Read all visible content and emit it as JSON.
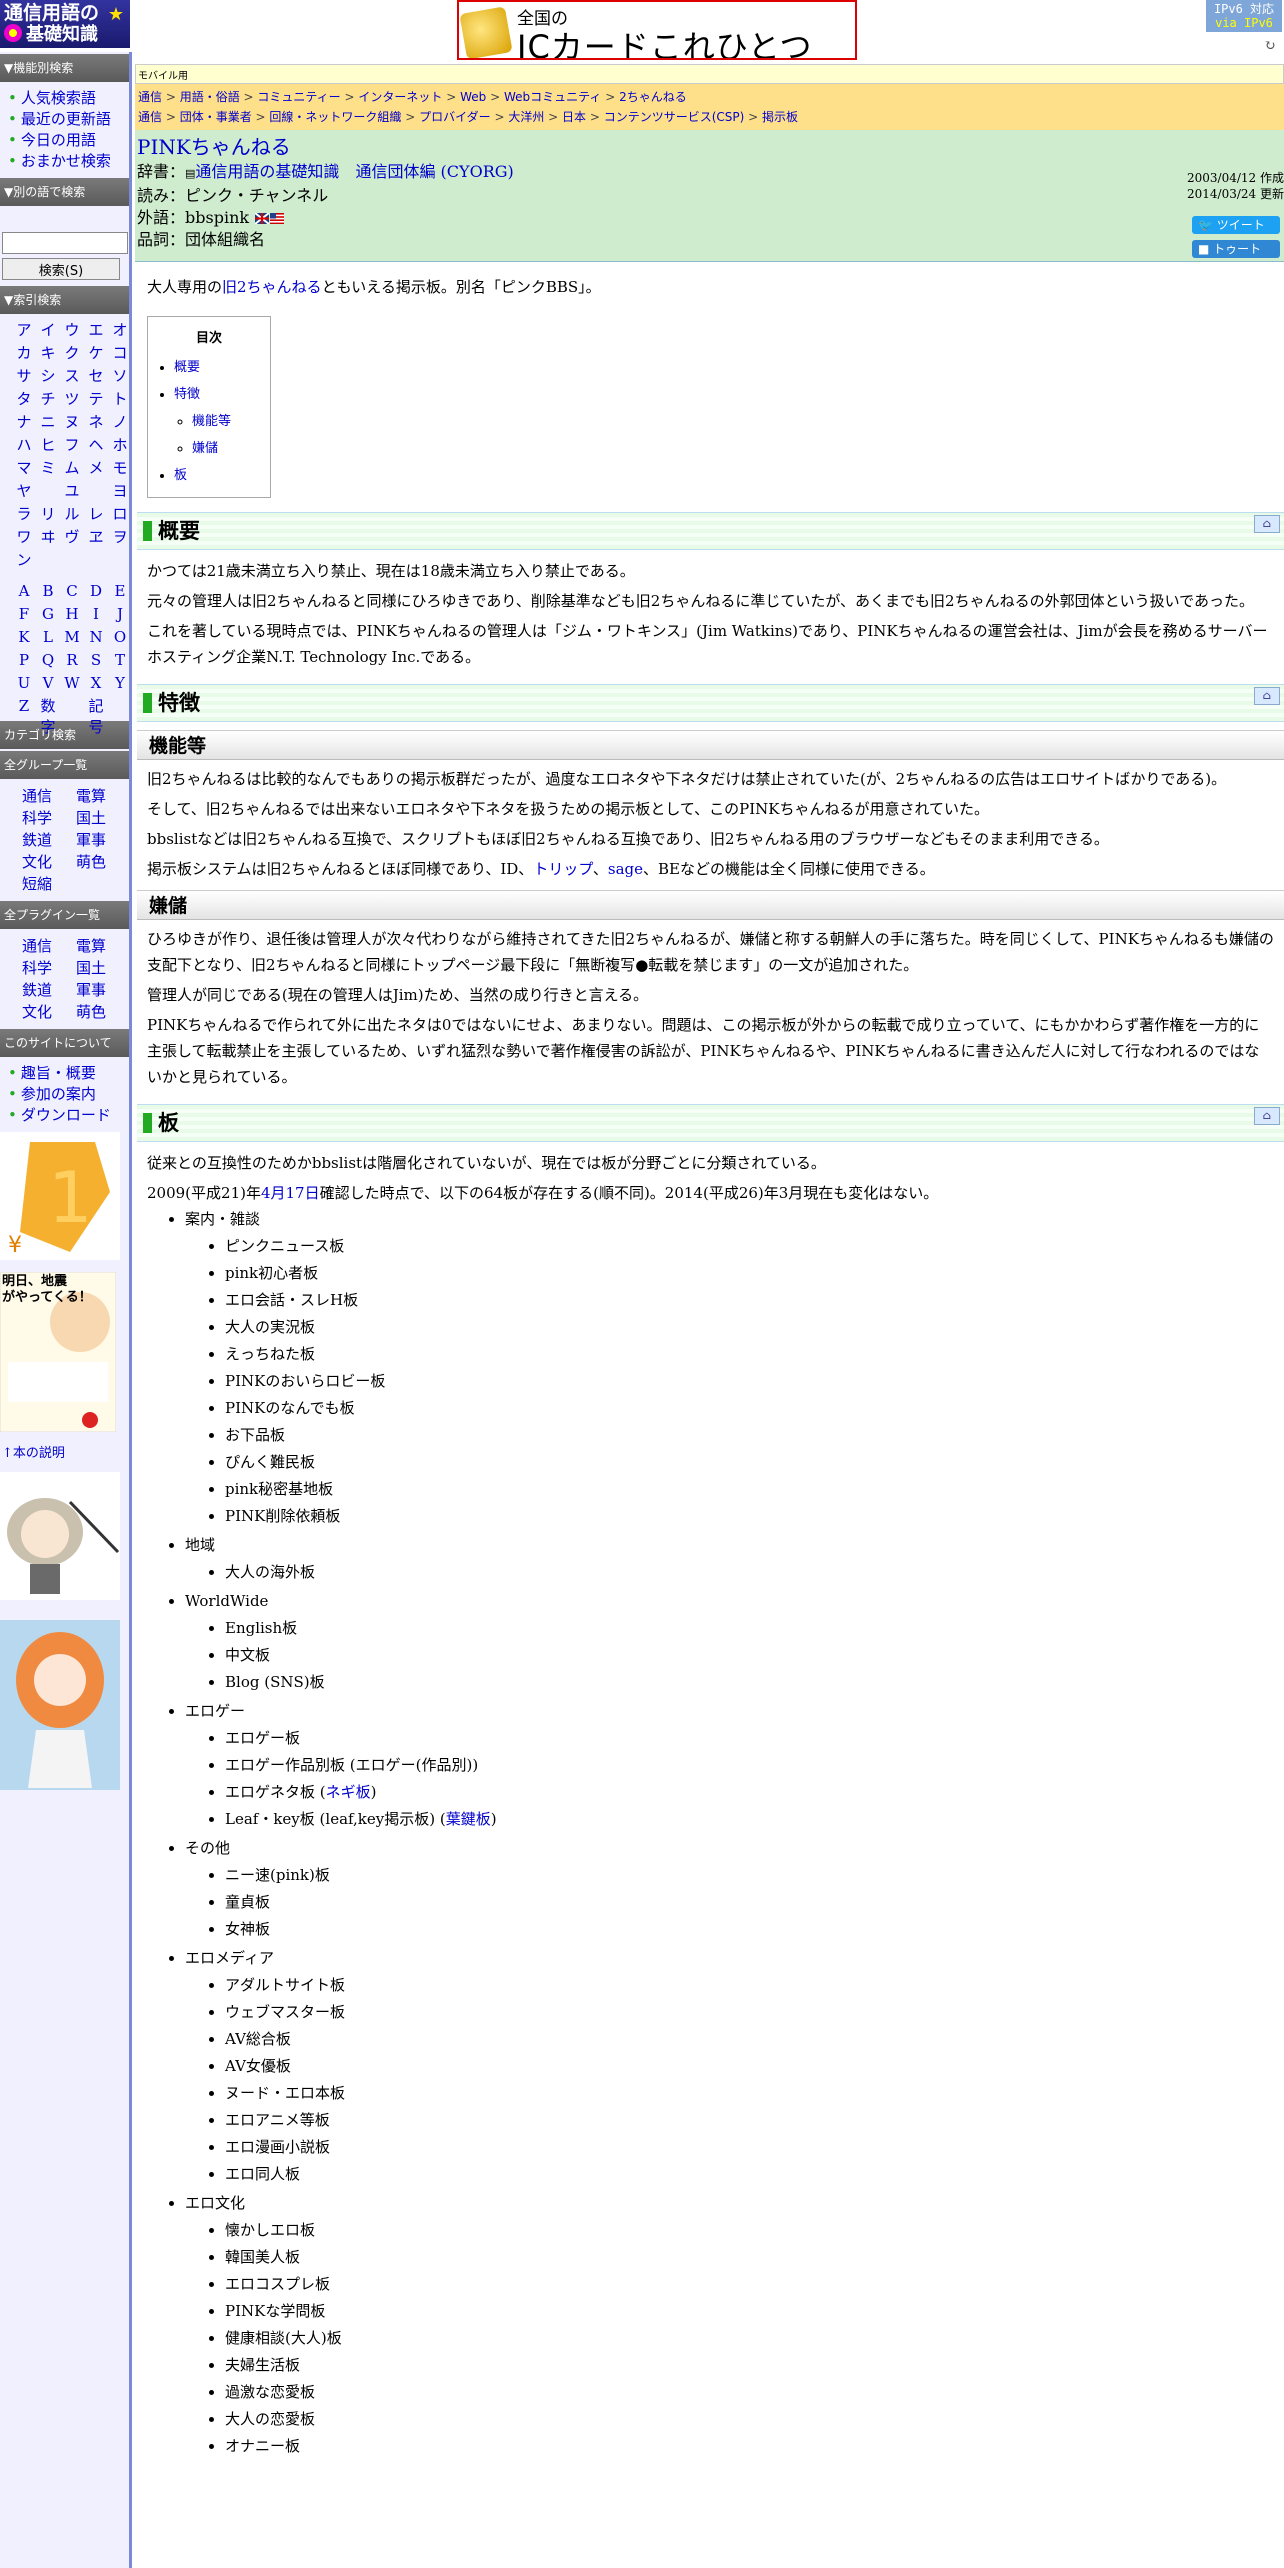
{
  "header": {
    "logo_line1": "通信用語の",
    "logo_line2": "基礎知識",
    "banner_small": "全国の",
    "banner_big": "ICカードこれひとつ",
    "ipv6_line1": "IPv6 対応",
    "ipv6_line2": "via IPv6"
  },
  "sidebar": {
    "feature_search_title": "▼機能別検索",
    "feature_links": [
      "人気検索語",
      "最近の更新語",
      "今日の用語",
      "おまかせ検索"
    ],
    "word_search_title": "▼別の語で検索",
    "search_button": "検索(S)",
    "index_title": "▼索引検索",
    "kana": [
      "ア",
      "イ",
      "ウ",
      "エ",
      "オ",
      "カ",
      "キ",
      "ク",
      "ケ",
      "コ",
      "サ",
      "シ",
      "ス",
      "セ",
      "ソ",
      "タ",
      "チ",
      "ツ",
      "テ",
      "ト",
      "ナ",
      "ニ",
      "ヌ",
      "ネ",
      "ノ",
      "ハ",
      "ヒ",
      "フ",
      "ヘ",
      "ホ",
      "マ",
      "ミ",
      "ム",
      "メ",
      "モ",
      "ヤ",
      "",
      "ユ",
      "",
      "ヨ",
      "ラ",
      "リ",
      "ル",
      "レ",
      "ロ",
      "ワ",
      "ヰ",
      "ヴ",
      "ヱ",
      "ヲ",
      "ン",
      "",
      "",
      "",
      ""
    ],
    "alpha": [
      "A",
      "B",
      "C",
      "D",
      "E",
      "F",
      "G",
      "H",
      "I",
      "J",
      "K",
      "L",
      "M",
      "N",
      "O",
      "P",
      "Q",
      "R",
      "S",
      "T",
      "U",
      "V",
      "W",
      "X",
      "Y",
      "Z",
      "数字",
      "",
      "記号",
      ""
    ],
    "category_title": "カテゴリ検索",
    "group_title": "全グループ一覧",
    "groups": [
      "通信",
      "電算",
      "科学",
      "国土",
      "鉄道",
      "軍事",
      "文化",
      "萌色",
      "短縮",
      ""
    ],
    "plugin_title": "全プラグイン一覧",
    "plugins": [
      "通信",
      "電算",
      "科学",
      "国土",
      "鉄道",
      "軍事",
      "文化",
      "萌色"
    ],
    "about_title": "このサイトについて",
    "about_links": [
      "趣旨・概要",
      "参加の案内",
      "ダウンロード"
    ],
    "ad_caption": "↑本の説明",
    "book_line1": "明日、地震",
    "book_line2": "がやってくる！"
  },
  "main": {
    "mobile_label": "モバイル用",
    "crumbs_row1": [
      "通信",
      "用語・俗語",
      "コミュニティー",
      "インターネット",
      "Web",
      "Webコミュニティ",
      "2ちゃんねる"
    ],
    "crumbs_row2": [
      "通信",
      "団体・事業者",
      "回線・ネットワーク組織",
      "プロバイダー",
      "大洋州",
      "日本",
      "コンテンツサービス(CSP)",
      "掲示板"
    ],
    "title": "PINKちゃんねる",
    "dict_label": "辞書：",
    "dict_value1": "通信用語の基礎知識",
    "dict_value2": "通信団体編 (CYORG)",
    "reading_label": "読み：",
    "reading_value": "ピンク・チャンネル",
    "foreign_label": "外語：",
    "foreign_value": "bbspink",
    "pos_label": "品詞：",
    "pos_value": "団体組織名",
    "date_created": "2003/04/12 作成",
    "date_updated": "2014/03/24 更新",
    "tweet": "ツイート",
    "toot": "トゥート",
    "intro_pre": "大人専用の",
    "intro_link": "旧2ちゃんねる",
    "intro_post": "ともいえる掲示板。別名「ピンクBBS」。",
    "toc_title": "目次",
    "toc": [
      "概要",
      "特徴",
      "機能等",
      "嫌儲",
      "板"
    ],
    "home_icon": "⌂",
    "h_overview": "概要",
    "p_overview": [
      "かつては21歳未満立ち入り禁止、現在は18歳未満立ち入り禁止である。",
      "元々の管理人は旧2ちゃんねると同様にひろゆきであり、削除基準なども旧2ちゃんねるに準じていたが、あくまでも旧2ちゃんねるの外郭団体という扱いであった。",
      "これを著している現時点では、PINKちゃんねるの管理人は「ジム・ワトキンス」(Jim Watkins)であり、PINKちゃんねるの運営会社は、Jimが会長を務めるサーバーホスティング企業N.T. Technology Inc.である。"
    ],
    "h_features": "特徴",
    "h_functions": "機能等",
    "p_functions": [
      "旧2ちゃんねるは比較的なんでもありの掲示板群だったが、過度なエロネタや下ネタだけは禁止されていた(が、2ちゃんねるの広告はエロサイトばかりである)。",
      "そして、旧2ちゃんねるでは出来ないエロネタや下ネタを扱うための掲示板として、このPINKちゃんねるが用意されていた。",
      "bbslistなどは旧2ちゃんねる互換で、スクリプトもほぼ旧2ちゃんねる互換であり、旧2ちゃんねる用のブラウザーなどもそのまま利用できる。"
    ],
    "p_func4_pre": "掲示板システムは旧2ちゃんねるとほぼ同様であり、ID、",
    "p_func4_link1": "トリップ",
    "p_func4_mid": "、",
    "p_func4_link2": "sage",
    "p_func4_post": "、BEなどの機能は全く同様に使用できる。",
    "h_kenmou": "嫌儲",
    "p_kenmou": [
      "ひろゆきが作り、退任後は管理人が次々代わりながら維持されてきた旧2ちゃんねるが、嫌儲と称する朝鮮人の手に落ちた。時を同じくして、PINKちゃんねるも嫌儲の支配下となり、旧2ちゃんねると同様にトップページ最下段に「無断複写●転載を禁じます」の一文が追加された。",
      "管理人が同じである(現在の管理人はJim)ため、当然の成り行きと言える。",
      "PINKちゃんねるで作られて外に出たネタは0ではないにせよ、あまりない。問題は、この掲示板が外からの転載で成り立っていて、にもかかわらず著作権を一方的に主張して転載禁止を主張しているため、いずれ猛烈な勢いで著作権侵害の訴訟が、PINKちゃんねるや、PINKちゃんねるに書き込んだ人に対して行なわれるのではないかと見られている。"
    ],
    "h_boards": "板",
    "p_boards1": "従来との互換性のためかbbslistは階層化されていないが、現在では板が分野ごとに分類されている。",
    "p_boards2_pre": "2009(平成21)年",
    "p_boards2_link": "4月17日",
    "p_boards2_post": "確認した時点で、以下の64板が存在する(順不同)。2014(平成26)年3月現在も変化はない。",
    "boards": [
      {
        "name": "案内・雑談",
        "items": [
          "ピンクニュース板",
          "pink初心者板",
          "エロ会話・スレH板",
          "大人の実況板",
          "えっちねた板",
          "PINKのおいらロビー板",
          "PINKのなんでも板",
          "お下品板",
          "ぴんく難民板",
          "pink秘密基地板",
          "PINK削除依頼板"
        ]
      },
      {
        "name": "地域",
        "items": [
          "大人の海外板"
        ]
      },
      {
        "name": "WorldWide",
        "items": [
          "English板",
          "中文板",
          "Blog (SNS)板"
        ]
      },
      {
        "name": "エロゲー",
        "items": [
          "エロゲー板",
          "エロゲー作品別板 (エロゲー(作品別))"
        ],
        "extra": {
          "negi_pre": "エロゲネタ板 (",
          "negi_link": "ネギ板",
          "negi_post": ")",
          "leaf_pre": "Leaf・key板 (leaf,key掲示板) (",
          "leaf_link": "葉鍵板",
          "leaf_post": ")"
        }
      },
      {
        "name": "その他",
        "items": [
          "ニー速(pink)板",
          "童貞板",
          "女神板"
        ]
      },
      {
        "name": "エロメディア",
        "items": [
          "アダルトサイト板",
          "ウェブマスター板",
          "AV総合板",
          "AV女優板",
          "ヌード・エロ本板",
          "エロアニメ等板",
          "エロ漫画小説板",
          "エロ同人板"
        ]
      },
      {
        "name": "エロ文化",
        "items": [
          "懐かしエロ板",
          "韓国美人板",
          "エロコスプレ板",
          "PINKな学問板",
          "健康相談(大人)板",
          "夫婦生活板",
          "過激な恋愛板",
          "大人の恋愛板",
          "オナニー板"
        ]
      }
    ]
  }
}
